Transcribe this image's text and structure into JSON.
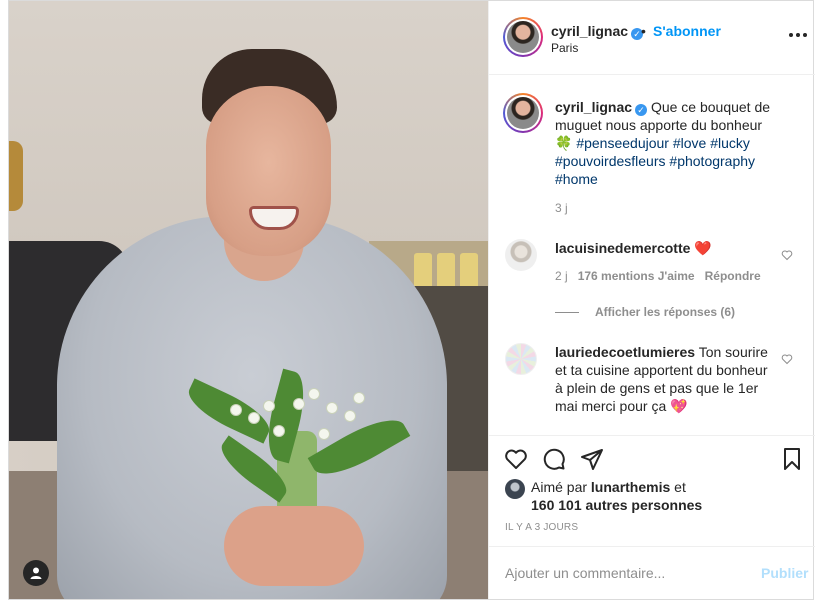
{
  "post": {
    "author": {
      "username": "cyril_lignac",
      "verified_icon": "verified-badge-icon",
      "subscribe_label": "S'abonner",
      "separator": "•",
      "location": "Paris"
    },
    "caption": {
      "username": "cyril_lignac",
      "text": "Que ce bouquet de muguet nous apporte du bonheur",
      "emoji": "🍀",
      "hashtags": [
        "#penseedujour",
        "#love",
        "#lucky",
        "#pouvoirdesfleurs",
        "#photography",
        "#home"
      ],
      "age": "3 j"
    },
    "comments": [
      {
        "username": "lacuisinedemercotte",
        "text": "",
        "emoji": "❤️",
        "age": "2 j",
        "likes_label": "176 mentions J'aime",
        "reply_label": "Répondre",
        "view_replies_label": "Afficher les réponses (6)"
      },
      {
        "username": "lauriedecoetlumieres",
        "text": "Ton sourire et ta cuisine apportent du bonheur à plein de gens et pas que le 1er mai merci pour ça",
        "emoji": "💖"
      }
    ],
    "likes": {
      "prefix": "Aimé par",
      "first_user": "lunarthemis",
      "conjunction": "et",
      "others": "160 101 autres personnes"
    },
    "time_ago": "IL Y A 3 JOURS",
    "add_comment_placeholder": "Ajouter un commentaire...",
    "publish_label": "Publier"
  },
  "colors": {
    "accent": "#0095f6",
    "hashtag": "#00376b",
    "muted": "#8e8e8e",
    "heart_red": "#ed4956",
    "publish_disabled": "#b2dffc"
  }
}
